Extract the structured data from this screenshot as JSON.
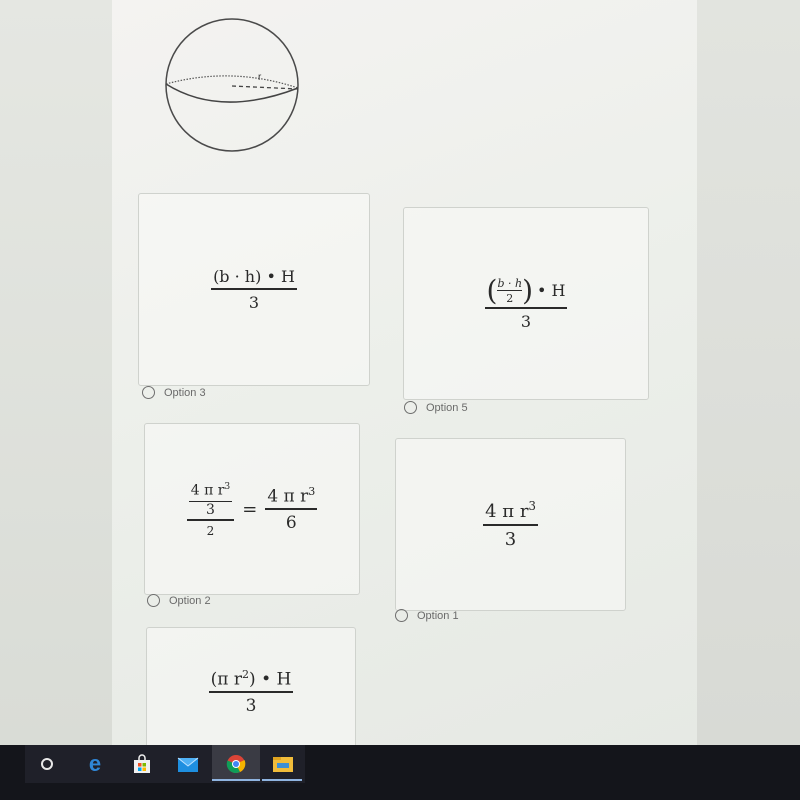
{
  "question": {
    "figure": {
      "type": "sphere",
      "label": "r"
    },
    "options": [
      {
        "id": "option-3",
        "label": "Option 3",
        "formula_text": "(b · h) • H / 3",
        "numerator": "(b · h) • H",
        "denominator": "3"
      },
      {
        "id": "option-5",
        "label": "Option 5",
        "formula_text": "((b · h)/2) • H / 3",
        "inner_numerator": "b · h",
        "inner_denominator": "2",
        "tail": "• H",
        "denominator": "3"
      },
      {
        "id": "option-2",
        "label": "Option 2",
        "formula_text": "((4 π r³)/3)/2 = 4 π r³ / 6",
        "inner_numerator": "4 π r",
        "inner_exp": "3",
        "inner_denominator": "3",
        "outer_denominator": "2",
        "equals": "=",
        "rhs_numerator": "4 π r",
        "rhs_exp": "3",
        "rhs_denominator": "6"
      },
      {
        "id": "option-1",
        "label": "Option 1",
        "formula_text": "4 π r³ / 3",
        "numerator": "4 π r",
        "exp": "3",
        "denominator": "3"
      },
      {
        "id": "option-4",
        "formula_text": "(π r²) • H / 3",
        "numerator_pre": "(π r",
        "exp": "2",
        "numerator_post": ") • H",
        "denominator": "3"
      }
    ]
  },
  "taskbar": {
    "icons": [
      "cortana-icon",
      "edge-icon",
      "store-icon",
      "mail-icon",
      "chrome-icon",
      "file-explorer-icon"
    ],
    "active": "chrome-icon"
  }
}
